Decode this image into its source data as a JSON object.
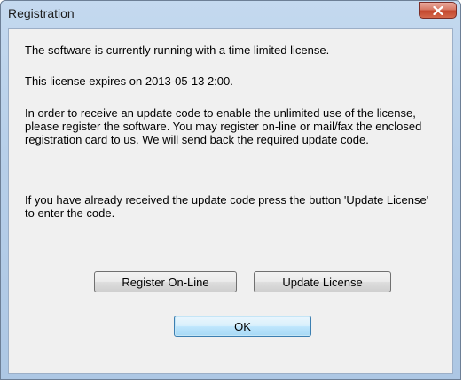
{
  "window": {
    "title": "Registration"
  },
  "message": {
    "line1": "The software is currently running with a time limited license.",
    "line2": "This license expires on 2013-05-13  2:00.",
    "para3": "In order to receive an update code to enable the unlimited use of the license, please register the software. You may register on-line or mail/fax the enclosed registration card to us. We will send back the required update code.",
    "para4": "If you have already received the update code press the button 'Update License' to enter the code."
  },
  "buttons": {
    "register_label": "Register On-Line",
    "update_label": "Update License",
    "ok_label": "OK"
  },
  "icons": {
    "close": "close-icon"
  }
}
